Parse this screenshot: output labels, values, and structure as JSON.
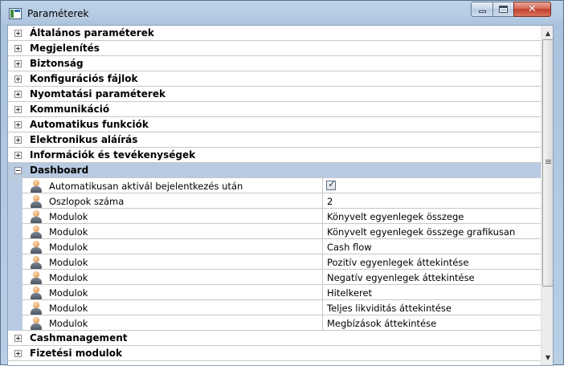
{
  "window": {
    "title": "Paraméterek",
    "icons": {
      "app": "app-icon",
      "minimize": "minimize-icon",
      "maximize": "maximize-icon",
      "close": "close-icon"
    },
    "close_symbol": "✕"
  },
  "categories_top": [
    {
      "label": "Általános paraméterek"
    },
    {
      "label": "Megjelenítés"
    },
    {
      "label": "Biztonság"
    },
    {
      "label": "Konfigurációs fájlok"
    },
    {
      "label": "Nyomtatási paraméterek"
    },
    {
      "label": "Kommunikáció"
    },
    {
      "label": "Automatikus funkciók"
    },
    {
      "label": "Elektronikus aláírás"
    },
    {
      "label": "Információk és tevékenységek"
    }
  ],
  "dashboard": {
    "label": "Dashboard",
    "properties": [
      {
        "name": "Automatikusan aktivál bejelentkezés után",
        "value": "",
        "checked": true
      },
      {
        "name": "Oszlopok száma",
        "value": "2"
      },
      {
        "name": "Modulok",
        "value": "Könyvelt egyenlegek összege"
      },
      {
        "name": "Modulok",
        "value": "Könyvelt egyenlegek összege grafikusan"
      },
      {
        "name": "Modulok",
        "value": "Cash flow"
      },
      {
        "name": "Modulok",
        "value": "Pozitív egyenlegek áttekintése"
      },
      {
        "name": "Modulok",
        "value": "Negatív egyenlegek áttekintése"
      },
      {
        "name": "Modulok",
        "value": "Hitelkeret"
      },
      {
        "name": "Modulok",
        "value": "Teljes likviditás áttekintése"
      },
      {
        "name": "Modulok",
        "value": "Megbízások áttekintése"
      }
    ]
  },
  "categories_bottom": [
    {
      "label": "Cashmanagement"
    },
    {
      "label": "Fizetési modulok"
    }
  ],
  "scrollbar": {
    "up_arrow": "▲",
    "down_arrow": "▼"
  },
  "colors": {
    "selected_row": "#b8cbe2",
    "grid_line": "#c8c8c8"
  }
}
